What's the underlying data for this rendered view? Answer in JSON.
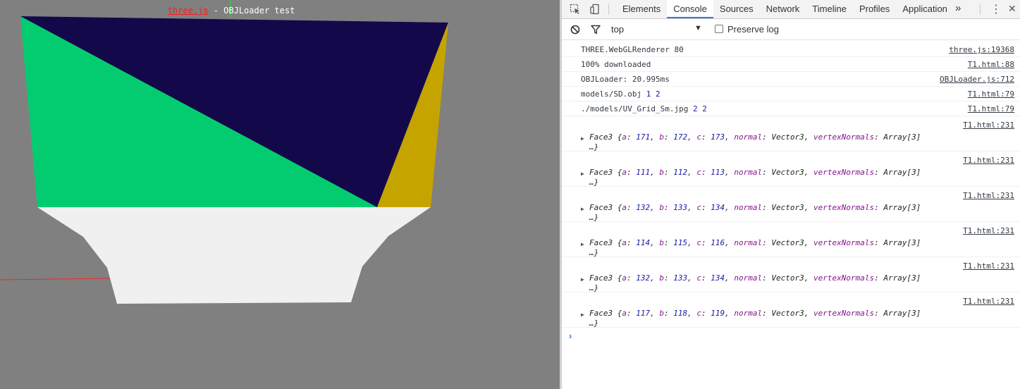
{
  "viewport": {
    "title_link": "three.js",
    "title_rest": " - OBJLoader test",
    "colors": {
      "background": "#808080",
      "navy": "#13094a",
      "green": "#03cc70",
      "gold": "#c5a400",
      "white": "#f0f0f0",
      "axis_red": "#ff2020",
      "axis_green": "#33dd33"
    }
  },
  "devtools": {
    "tabs": [
      {
        "label": "Elements",
        "active": false
      },
      {
        "label": "Console",
        "active": true
      },
      {
        "label": "Sources",
        "active": false
      },
      {
        "label": "Network",
        "active": false
      },
      {
        "label": "Timeline",
        "active": false
      },
      {
        "label": "Profiles",
        "active": false
      },
      {
        "label": "Application",
        "active": false
      }
    ],
    "more_tabs": "»",
    "kebab": "⋮",
    "close": "✕",
    "context": "top",
    "context_arrow": "▼",
    "preserve_log": "Preserve log",
    "messages": [
      {
        "text": "THREE.WebGLRenderer 80",
        "source": "three.js:19368"
      },
      {
        "text": "100% downloaded",
        "source": "T1.html:88"
      },
      {
        "text": "OBJLoader: 20.995ms",
        "source": "OBJLoader.js:712"
      },
      {
        "text": "models/SD.obj",
        "n1": "1",
        "n2": "2",
        "source": "T1.html:79"
      },
      {
        "text": "./models/UV_Grid_Sm.jpg",
        "n1": "2",
        "n2": "2",
        "source": "T1.html:79"
      }
    ],
    "faces": [
      {
        "a": "171",
        "b": "172",
        "c": "173",
        "source": "T1.html:231"
      },
      {
        "a": "111",
        "b": "112",
        "c": "113",
        "source": "T1.html:231"
      },
      {
        "a": "132",
        "b": "133",
        "c": "134",
        "source": "T1.html:231"
      },
      {
        "a": "114",
        "b": "115",
        "c": "116",
        "source": "T1.html:231"
      },
      {
        "a": "132",
        "b": "133",
        "c": "134",
        "source": "T1.html:231"
      },
      {
        "a": "117",
        "b": "118",
        "c": "119",
        "source": "T1.html:231"
      }
    ],
    "face_labels": {
      "class": "Face3",
      "normal_value": "Vector3",
      "vertex_normals_value": "Array[3]",
      "ellipsis": "…}"
    },
    "prompt": "›"
  }
}
